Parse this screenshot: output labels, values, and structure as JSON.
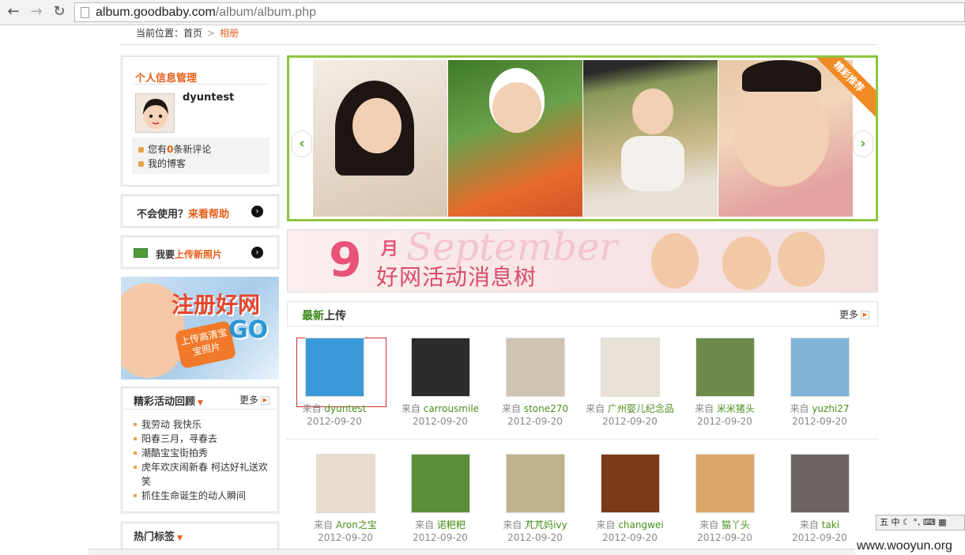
{
  "browser": {
    "back": "←",
    "forward": "→",
    "reload": "↻",
    "url_host": "album.goodbaby.com",
    "url_path": "/album/album.php"
  },
  "breadcrumb": {
    "label": "当前位置：",
    "home": "首页",
    "sep": ">",
    "current": "相册"
  },
  "profile": {
    "title": "个人信息管理",
    "username": "dyuntest",
    "comments_prefix": "您有",
    "comments_count": "0",
    "comments_suffix": "条新评论",
    "blog": "我的博客"
  },
  "help": {
    "text": "不会使用？",
    "link": "来看帮助",
    "arrow": "›"
  },
  "upload": {
    "text": "我要",
    "link": "上传新照片",
    "arrow": "›"
  },
  "register_ad": {
    "title": "注册好网",
    "badge": "上传高清宝宝照片",
    "go": "GO"
  },
  "recap": {
    "title": "精彩活动回顾",
    "arrow": "▼",
    "more": "更多",
    "more_icon": "▶",
    "items": [
      "我劳动 我快乐",
      "阳春三月，寻春去",
      "潮酷宝宝街拍秀",
      "虎年欢庆闹新春 柯达好礼送欢笑",
      "抓住生命诞生的动人瞬间"
    ]
  },
  "tags": {
    "title": "热门标签",
    "arrow": "▼"
  },
  "slider": {
    "ribbon": "精彩推荐",
    "prev": "‹",
    "next": "›"
  },
  "banner": {
    "number": "9",
    "month": "月",
    "script": "September",
    "subtitle": "好网活动消息树"
  },
  "latest": {
    "title_a": "最新",
    "title_b": "上传",
    "more": "更多",
    "more_icon": "▶",
    "from_label": "来自",
    "items": [
      {
        "user": "dyuntest",
        "date": "2012-09-20",
        "color": "#3a9ad9"
      },
      {
        "user": "carrousmile",
        "date": "2012-09-20",
        "color": "#2b2b2b"
      },
      {
        "user": "stone270",
        "date": "2012-09-20",
        "color": "#cfc3b2"
      },
      {
        "user": "广州婴儿纪念品",
        "date": "2012-09-20",
        "color": "#e8e2d6"
      },
      {
        "user": "米米猪头",
        "date": "2012-09-20",
        "color": "#6e8a4a"
      },
      {
        "user": "yuzhi27",
        "date": "2012-09-20",
        "color": "#7fb4d8"
      },
      {
        "user": "Aron之宝",
        "date": "2012-09-20",
        "color": "#e9dccd"
      },
      {
        "user": "诺粑粑",
        "date": "2012-09-20",
        "color": "#5c8e3a"
      },
      {
        "user": "芃芃妈ivy",
        "date": "2012-09-20",
        "color": "#bfb28a"
      },
      {
        "user": "changwei",
        "date": "2012-09-20",
        "color": "#7a3a18"
      },
      {
        "user": "猫丫头",
        "date": "2012-09-20",
        "color": "#d9a868"
      },
      {
        "user": "taki",
        "date": "2012-09-20",
        "color": "#6b6461"
      }
    ]
  },
  "ime": {
    "text": "五 中 ☾ °, ⌨ ▦"
  },
  "watermark": {
    "text": "www.wooyun.org"
  }
}
